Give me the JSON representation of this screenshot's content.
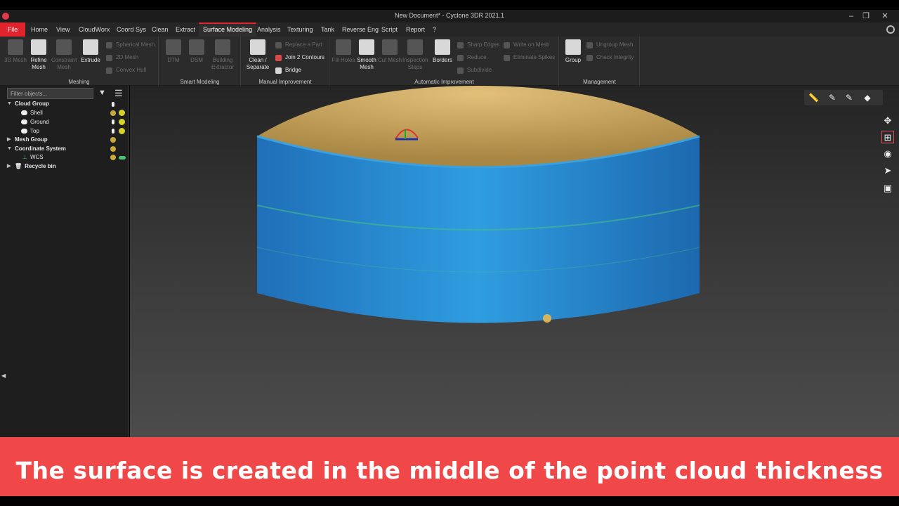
{
  "window": {
    "title": "New Document* - Cyclone 3DR 2021.1",
    "controls": [
      "–",
      "❐",
      "✕"
    ]
  },
  "menu": {
    "items": [
      {
        "label": "File",
        "kind": "file"
      },
      {
        "label": "Home"
      },
      {
        "label": "View"
      },
      {
        "label": "CloudWorx"
      },
      {
        "label": "Coord Sys"
      },
      {
        "label": "Clean"
      },
      {
        "label": "Extract"
      },
      {
        "label": "Surface Modeling",
        "active": true
      },
      {
        "label": "Analysis"
      },
      {
        "label": "Texturing"
      },
      {
        "label": "Tank"
      },
      {
        "label": "Reverse Eng"
      },
      {
        "label": "Script"
      },
      {
        "label": "Report"
      },
      {
        "label": "?"
      }
    ]
  },
  "ribbon": {
    "meshing": {
      "label": "Meshing",
      "mesh3d": "3D Mesh",
      "refine": "Refine Mesh",
      "constraint": "Constraint Mesh",
      "extrude": "Extrude",
      "spherical": "Spherical Mesh",
      "mesh2d": "2D Mesh",
      "convex": "Convex Hull"
    },
    "smart": {
      "label": "Smart Modeling",
      "dtm": "DTM",
      "dsm": "DSM",
      "building": "Building Extractor"
    },
    "manual": {
      "label": "Manual Improvement",
      "clean": "Clean / Separate",
      "replace": "Replace a Part",
      "join": "Join 2 Contours",
      "bridge": "Bridge"
    },
    "automatic": {
      "label": "Automatic Improvement",
      "fill": "Fill Holes",
      "smooth": "Smooth Mesh",
      "cut": "Cut Mesh",
      "inspection": "Inspection Steps",
      "borders": "Borders",
      "sharp": "Sharp Edges",
      "reduce": "Reduce",
      "subdivide": "Subdivide",
      "write": "Write on Mesh",
      "spikes": "Eliminate Spikes"
    },
    "management": {
      "label": "Management",
      "group": "Group",
      "ungroup": "Ungroup Mesh",
      "integrity": "Check Integrity"
    }
  },
  "panel": {
    "filter_placeholder": "Filter objects...",
    "tree": [
      {
        "label": "Cloud Group",
        "bold": true
      },
      {
        "label": "Shell"
      },
      {
        "label": "Ground"
      },
      {
        "label": "Top"
      },
      {
        "label": "Mesh Group",
        "bold": true
      },
      {
        "label": "Coordinate System",
        "bold": true
      },
      {
        "label": "WCS"
      },
      {
        "label": "Recycle bin",
        "bold": true
      }
    ]
  },
  "viewport": {
    "object": "tank point cloud",
    "colors": {
      "shell": "#2b8fd6",
      "roof": "#c9a55a",
      "background": "#3a3a3a"
    }
  },
  "caption": "The surface is created in the middle of the point cloud thickness",
  "colors": {
    "accent": "#e1232d",
    "banner": "#f04848"
  }
}
